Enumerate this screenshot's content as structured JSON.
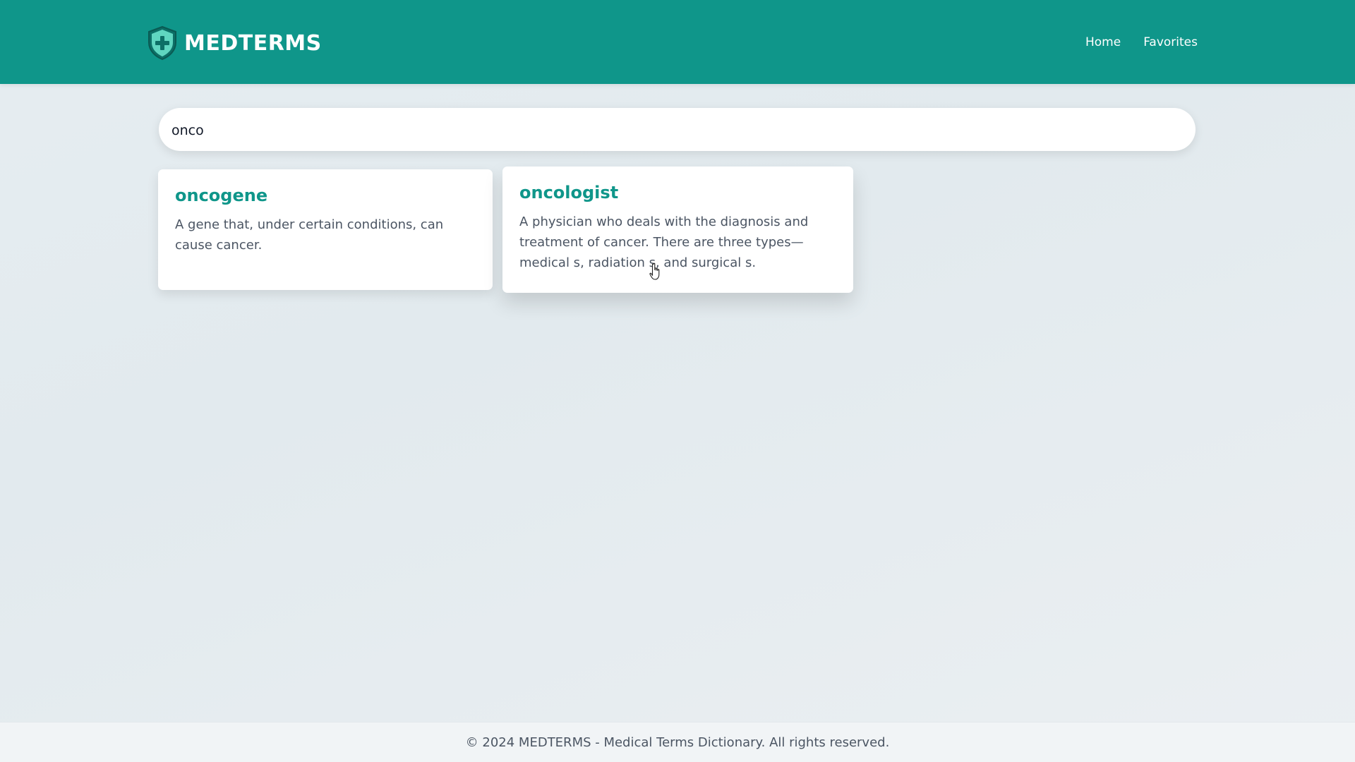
{
  "header": {
    "brand": "MEDTERMS",
    "logo_icon": "shield-plus-icon",
    "nav": [
      {
        "label": "Home"
      },
      {
        "label": "Favorites"
      }
    ],
    "background_color": "#0f968a"
  },
  "search": {
    "value": "onco",
    "placeholder": ""
  },
  "results": [
    {
      "term": "oncogene",
      "definition": "A gene that, under certain conditions, can cause cancer."
    },
    {
      "term": "oncologist",
      "definition": "A physician who deals with the diagnosis and treatment of cancer. There are three types—medical s, radiation s, and surgical s."
    }
  ],
  "footer": {
    "text": "© 2024 MEDTERMS - Medical Terms Dictionary. All rights reserved."
  },
  "colors": {
    "accent": "#0f968a",
    "page_background": "#e6edf1"
  }
}
